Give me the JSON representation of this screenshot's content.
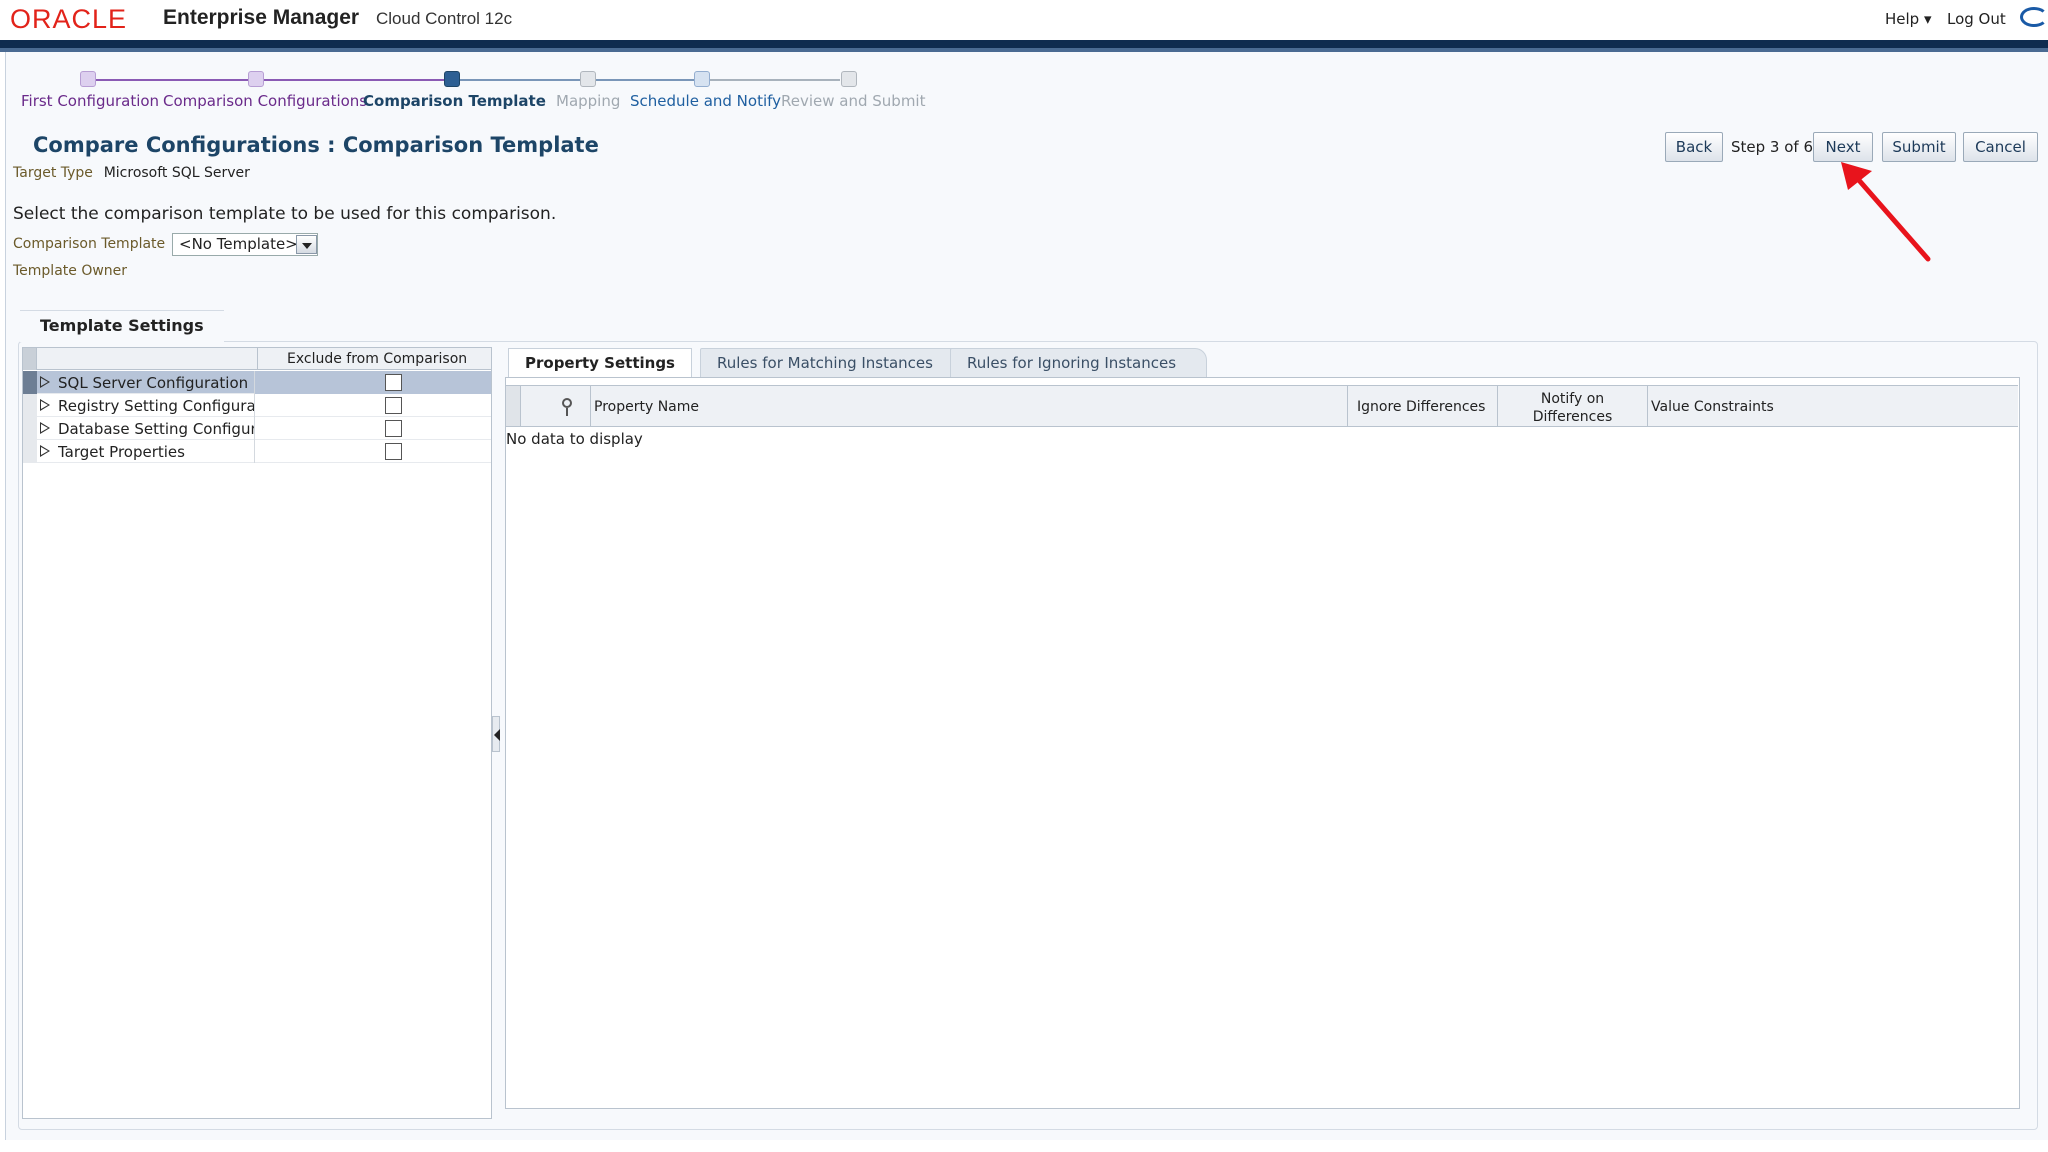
{
  "header": {
    "brand": "ORACLE",
    "product": "Enterprise Manager",
    "edition": "Cloud Control 12c",
    "help_label": "Help ▾",
    "logout_label": "Log Out"
  },
  "train": {
    "steps": [
      {
        "label": "First Configuration",
        "state": "visited"
      },
      {
        "label": "Comparison Configurations",
        "state": "visited"
      },
      {
        "label": "Comparison Template",
        "state": "current"
      },
      {
        "label": "Mapping",
        "state": "disabled"
      },
      {
        "label": "Schedule and Notify",
        "state": "unvisited"
      },
      {
        "label": "Review and Submit",
        "state": "disabled"
      }
    ]
  },
  "page": {
    "title": "Compare Configurations : Comparison Template",
    "target_type_label": "Target Type",
    "target_type_value": "Microsoft SQL Server",
    "instructions": "Select the comparison template to be used for this comparison.",
    "comparison_template_label": "Comparison Template",
    "comparison_template_value": "<No Template>",
    "template_owner_label": "Template Owner"
  },
  "buttons": {
    "back": "Back",
    "step_text": "Step 3 of 6",
    "next": "Next",
    "submit": "Submit",
    "cancel": "Cancel"
  },
  "template_settings": {
    "tab_label": "Template Settings",
    "tree_column": "Exclude from Comparison",
    "tree_rows": [
      {
        "label": "SQL Server Configuration",
        "selected": true,
        "excluded": false
      },
      {
        "label": "Registry Setting Configurati",
        "selected": false,
        "excluded": false
      },
      {
        "label": "Database Setting Configura",
        "selected": false,
        "excluded": false
      },
      {
        "label": "Target Properties",
        "selected": false,
        "excluded": false
      }
    ],
    "tabs": [
      "Property Settings",
      "Rules for Matching Instances",
      "Rules for Ignoring Instances"
    ],
    "grid_columns": {
      "property_name": "Property Name",
      "ignore_differences": "Ignore Differences",
      "notify_line1": "Notify on",
      "notify_line2": "Differences",
      "value_constraints": "Value Constraints"
    },
    "empty_text": "No data to display"
  },
  "colors": {
    "oracle_red": "#e2231a",
    "header_dark": "#0f2b4f",
    "title_blue": "#1d4567",
    "visited_purple": "#6a2a8a",
    "current_blue": "#1d4567",
    "link_blue": "#1f5fa0",
    "disabled_gray": "#a0a8b0",
    "selection": "#b7c4d8",
    "annotation_arrow": "#e8141c"
  }
}
